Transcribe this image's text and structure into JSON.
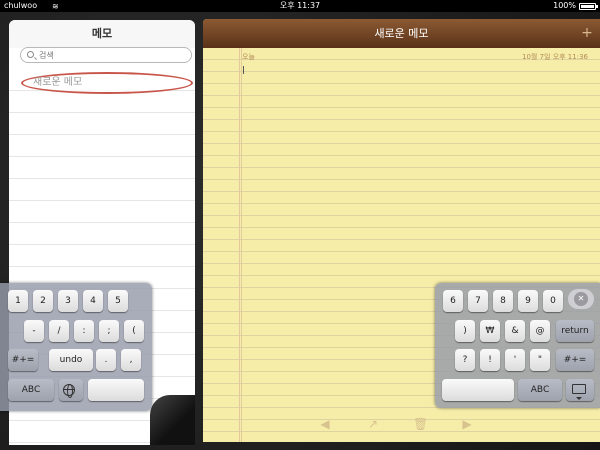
{
  "status": {
    "carrier": "chulwoo",
    "time": "오후 11:37",
    "battery": "100%"
  },
  "sidebar": {
    "title": "메모",
    "search_placeholder": "검색",
    "items": [
      {
        "label": "새로운 메모",
        "selected": true
      }
    ]
  },
  "note": {
    "title": "새로운 메모",
    "add_label": "+",
    "today": "오늘",
    "datetime": "10월 7일  오후 11:36",
    "toolbar": {
      "back": "◀",
      "share": "↗",
      "trash": "🗑",
      "forward": "▶"
    }
  },
  "keyboard_left": {
    "row1": [
      "1",
      "2",
      "3",
      "4",
      "5"
    ],
    "row2": [
      "-",
      "/",
      ":",
      ";",
      "("
    ],
    "row3": [
      "#+=",
      "undo",
      ".",
      ","
    ],
    "row4": [
      "ABC",
      "globe",
      ""
    ]
  },
  "keyboard_right": {
    "row1": [
      "6",
      "7",
      "8",
      "9",
      "0"
    ],
    "row2": [
      ")",
      "₩",
      "&",
      "@",
      "return"
    ],
    "row3": [
      "?",
      "!",
      "'",
      "\"",
      "#+="
    ],
    "row4": [
      "",
      "ABC",
      "hide-keyboard"
    ]
  },
  "colors": {
    "paper": "#f6eea8",
    "header_leather": "#6e4124",
    "selection_circle": "#c8554a"
  }
}
